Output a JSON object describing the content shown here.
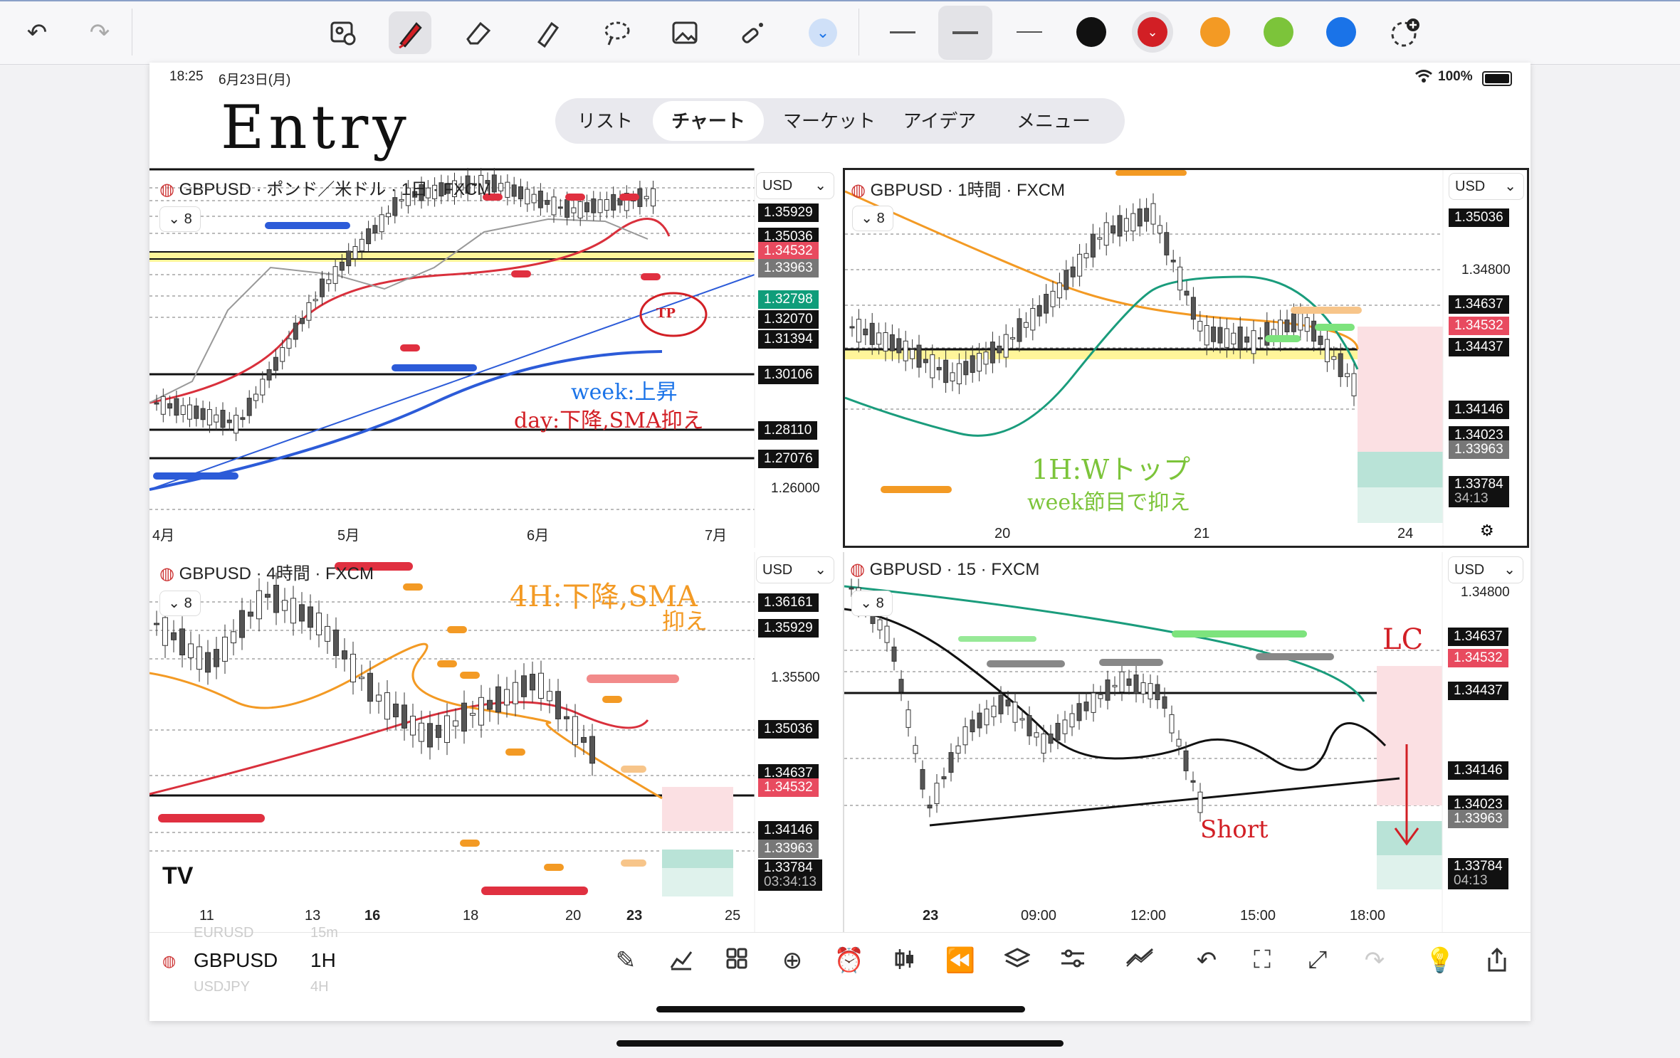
{
  "toolbar": {
    "undo_icon": "undo-icon",
    "redo_icon": "redo-icon",
    "tools": [
      "image-insert-icon",
      "pen-icon",
      "eraser-icon",
      "highlighter-icon",
      "lasso-icon",
      "image-icon",
      "magic-wand-icon",
      "chevron-down-icon"
    ],
    "colors": [
      "#111111",
      "#d21f25",
      "#f39a24",
      "#7cc43a",
      "#1a73e8"
    ],
    "add_color_icon": "add-color-icon"
  },
  "status_bar": {
    "time": "18:25",
    "date": "6月23日(月)",
    "battery": "100%"
  },
  "nav": {
    "items": [
      "リスト",
      "チャート",
      "マーケット",
      "アイデア",
      "メニュー"
    ],
    "active": "チャート"
  },
  "handwriting": {
    "entry": "Entry",
    "tp": "TP",
    "daily_note_1": "week:上昇",
    "daily_note_2": "day:下降,SMA抑え",
    "h1_note_1": "1H:Wトップ",
    "h1_note_2": "week節目で抑え",
    "h4_note_1": "4H:下降,SMA",
    "h4_note_2": "抑え",
    "m15_note_lc": "LC",
    "m15_note_short": "Short"
  },
  "charts": {
    "daily": {
      "title": "GBPUSD · ポンド／米ドル · 1日 · FXCM",
      "currency": "USD",
      "indicator_count": "8",
      "prices": {
        "p1": "1.35929",
        "p2": "1.35036",
        "p3": "1.34532",
        "p4": "1.33963",
        "p5": "1.32798",
        "p6": "1.32070",
        "p7": "1.31394",
        "p8": "1.30106",
        "p9": "1.28110",
        "p10": "1.27076",
        "p11": "1.26000"
      },
      "x_labels": [
        "4月",
        "5月",
        "6月",
        "7月"
      ]
    },
    "h1": {
      "title": "GBPUSD · 1時間 · FXCM",
      "currency": "USD",
      "indicator_count": "8",
      "prices": {
        "p1": "1.35036",
        "p2": "1.34800",
        "p3": "1.34637",
        "p4": "1.34532",
        "p5": "1.34437",
        "p6": "1.34146",
        "p7": "1.34023",
        "p8": "1.33963",
        "p9": "1.33784",
        "timer": "34:13"
      },
      "x_labels": [
        "20",
        "21",
        "24"
      ]
    },
    "h4": {
      "title": "GBPUSD · 4時間 · FXCM",
      "currency": "USD",
      "indicator_count": "8",
      "prices": {
        "p1": "1.36161",
        "p2": "1.35929",
        "p3": "1.35500",
        "p4": "1.35036",
        "p5": "1.34637",
        "p6": "1.34532",
        "p7": "1.34146",
        "p8": "1.33963",
        "p9": "1.33784",
        "timer": "03:34:13"
      },
      "x_labels": [
        "11",
        "13",
        "16",
        "18",
        "20",
        "23",
        "25"
      ]
    },
    "m15": {
      "title": "GBPUSD · 15 · FXCM",
      "currency": "USD",
      "indicator_count": "8",
      "prices": {
        "p1": "1.34800",
        "p2": "1.34637",
        "p3": "1.34532",
        "p4": "1.34437",
        "p5": "1.34146",
        "p6": "1.34023",
        "p7": "1.33963",
        "p8": "1.33784",
        "timer": "04:13"
      },
      "x_labels": [
        "23",
        "09:00",
        "12:00",
        "15:00",
        "18:00"
      ]
    }
  },
  "bottom_bar": {
    "symbol": "GBPUSD",
    "interval": "1H",
    "ghost_above_symbol": "EURUSD",
    "ghost_above_interval": "15m",
    "ghost_below_symbol": "USDJPY",
    "ghost_below_interval": "4H",
    "icons": [
      "drawing-tools-icon",
      "indicators-icon",
      "layout-icon",
      "add-icon",
      "alert-icon",
      "chart-type-icon",
      "replay-icon",
      "layers-icon",
      "settings-icon",
      "compare-icon",
      "undo-icon",
      "fullscreen-icon",
      "expand-icon",
      "redo-icon",
      "idea-icon",
      "share-icon"
    ]
  },
  "tv_logo": "TV"
}
